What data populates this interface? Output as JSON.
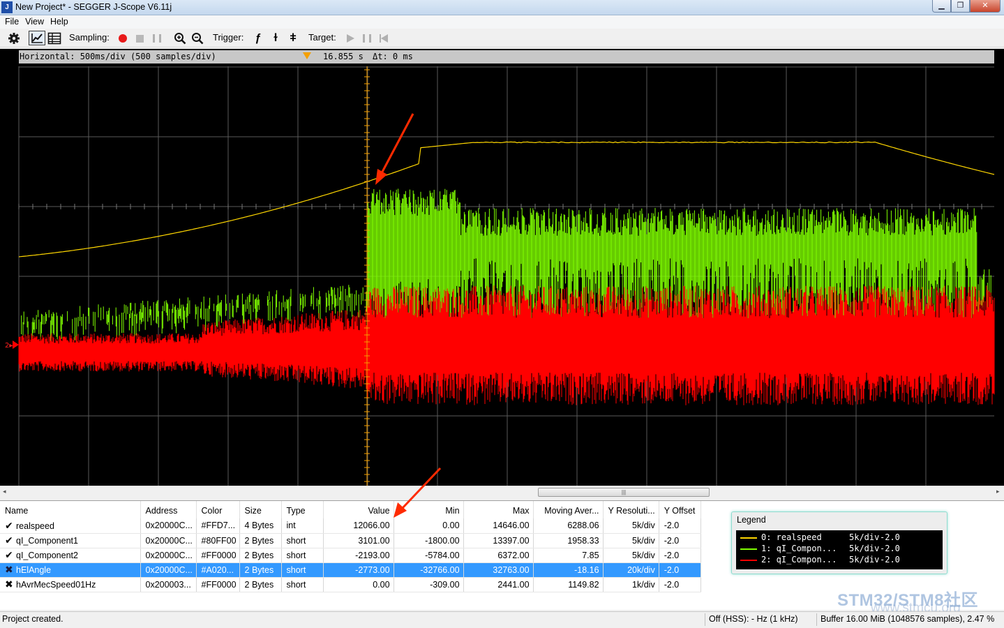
{
  "window": {
    "title": "New Project* - SEGGER J-Scope V6.11j",
    "app_icon_text": "J",
    "minimize_glyph": "▁",
    "maximize_glyph": "❐",
    "close_glyph": "✕"
  },
  "menu": {
    "items": [
      "File",
      "View",
      "Help"
    ]
  },
  "toolbar": {
    "sampling_label": "Sampling:",
    "trigger_label": "Trigger:",
    "target_label": "Target:",
    "icons": [
      "gear-icon",
      "line-chart-icon",
      "table-icon",
      "record-icon",
      "stop-icon",
      "pause-icon",
      "zoom-in-icon",
      "zoom-out-icon",
      "trigger-rising-icon",
      "trigger-falling-icon",
      "trigger-both-icon",
      "play-icon",
      "pause-icon",
      "skip-back-icon"
    ],
    "trigger_rising_glyph": "ƒ",
    "trigger_falling_glyph": "ɫ",
    "trigger_both_glyph": "ǂ"
  },
  "scope": {
    "horizontal": "Horizontal: 500ms/div (500 samples/div)",
    "trigger_time": "16.855 s",
    "delta_t": "Δt: 0 ms",
    "channel_marker": "2▸",
    "colors": {
      "realspeed": "#FFD700",
      "qI_Component1": "#80FF00",
      "qI_Component2": "#FF0000",
      "grid": "#5a5a5a",
      "cursor": "#f5a000"
    }
  },
  "hscroll": {
    "left_arrow": "◂",
    "right_arrow": "▸",
    "thumb_grip": "|||"
  },
  "table": {
    "columns": [
      "Name",
      "Address",
      "Color",
      "Size",
      "Type",
      "Value",
      "Min",
      "Max",
      "Moving Aver...",
      "Y Resoluti...",
      "Y Offset"
    ],
    "rows": [
      {
        "icon": "✔",
        "name": "realspeed",
        "address": "0x20000C...",
        "color": "#FFD7...",
        "size": "4 Bytes",
        "type": "int",
        "value": "12066.00",
        "min": "0.00",
        "max": "14646.00",
        "avg": "6288.06",
        "yres": "5k/div",
        "yoff": "-2.0"
      },
      {
        "icon": "✔",
        "name": "qI_Component1",
        "address": "0x20000C...",
        "color": "#80FF00",
        "size": "2 Bytes",
        "type": "short",
        "value": "3101.00",
        "min": "-1800.00",
        "max": "13397.00",
        "avg": "1958.33",
        "yres": "5k/div",
        "yoff": "-2.0"
      },
      {
        "icon": "✔",
        "name": "qI_Component2",
        "address": "0x20000C...",
        "color": "#FF0000",
        "size": "2 Bytes",
        "type": "short",
        "value": "-2193.00",
        "min": "-5784.00",
        "max": "6372.00",
        "avg": "7.85",
        "yres": "5k/div",
        "yoff": "-2.0"
      },
      {
        "icon": "✖",
        "name": "hElAngle",
        "address": "0x20000C...",
        "color": "#A020...",
        "size": "2 Bytes",
        "type": "short",
        "value": "-2773.00",
        "min": "-32766.00",
        "max": "32763.00",
        "avg": "-18.16",
        "yres": "20k/div",
        "yoff": "-2.0"
      },
      {
        "icon": "✖",
        "name": "hAvrMecSpeed01Hz",
        "address": "0x200003...",
        "color": "#FF0000",
        "size": "2 Bytes",
        "type": "short",
        "value": "0.00",
        "min": "-309.00",
        "max": "2441.00",
        "avg": "1149.82",
        "yres": "1k/div",
        "yoff": "-2.0"
      }
    ],
    "selected_row": 3
  },
  "legend": {
    "title": "Legend",
    "entries": [
      {
        "label": "0: realspeed",
        "res": "5k/div",
        "offset": "-2.0",
        "color": "#FFD700"
      },
      {
        "label": "1: qI_Compon...",
        "res": "5k/div",
        "offset": "-2.0",
        "color": "#80FF00"
      },
      {
        "label": "2: qI_Compon...",
        "res": "5k/div",
        "offset": "-2.0",
        "color": "#FF0000"
      }
    ]
  },
  "status": {
    "left": "Project created.",
    "clock": "Off (HSS): - Hz (1 kHz)",
    "buffer": "Buffer 16.00 MiB (1048576 samples), 2.47 %"
  },
  "watermark": {
    "main": "STM32/STM8社区",
    "sub": "www.stmcu.org"
  }
}
